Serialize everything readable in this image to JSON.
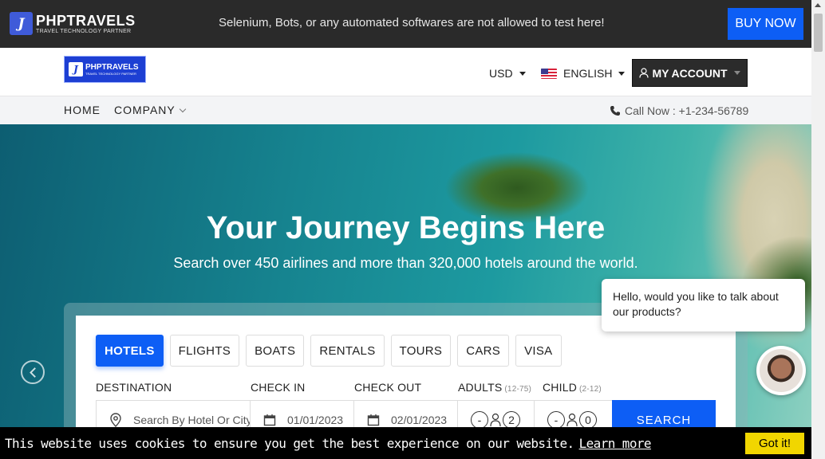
{
  "topbar": {
    "logo_title": "PHPTRAVELS",
    "logo_tagline": "TRAVEL TECHNOLOGY PARTNER",
    "notice": "Selenium, Bots, or any automated softwares are not allowed to test here!",
    "buy_label": "BUY NOW"
  },
  "header": {
    "logo_title": "PHPTRAVELS",
    "logo_tagline": "TRAVEL TECHNOLOGY PARTNER",
    "currency": "USD",
    "language": "ENGLISH",
    "account_label": "MY ACCOUNT"
  },
  "nav": {
    "home": "HOME",
    "company": "COMPANY",
    "call": "Call Now : +1-234-56789"
  },
  "hero": {
    "title": "Your Journey Begins Here",
    "subtitle": "Search over 450 airlines and more than 320,000 hotels around the world."
  },
  "search": {
    "tabs": [
      "HOTELS",
      "FLIGHTS",
      "BOATS",
      "RENTALS",
      "TOURS",
      "CARS",
      "VISA"
    ],
    "active_tab": "HOTELS",
    "destination_label": "DESTINATION",
    "destination_placeholder": "Search By Hotel Or City Name",
    "checkin_label": "CHECK IN",
    "checkin_value": "01/01/2023",
    "checkout_label": "CHECK OUT",
    "checkout_value": "02/01/2023",
    "adults_label": "ADULTS",
    "adults_range": "(12-75)",
    "adults_value": "2",
    "child_label": "CHILD",
    "child_range": "(2-12)",
    "child_value": "0",
    "search_label": "SEARCH"
  },
  "chat": {
    "message": "Hello, would you like to talk about our products?"
  },
  "cookie": {
    "text": "This website uses cookies to ensure you get the best experience on our website.",
    "link": "Learn more",
    "button": "Got it!"
  },
  "colors": {
    "primary": "#0d5ef5",
    "topbar": "#2a2a2a",
    "cookie_button": "#f1d600"
  }
}
